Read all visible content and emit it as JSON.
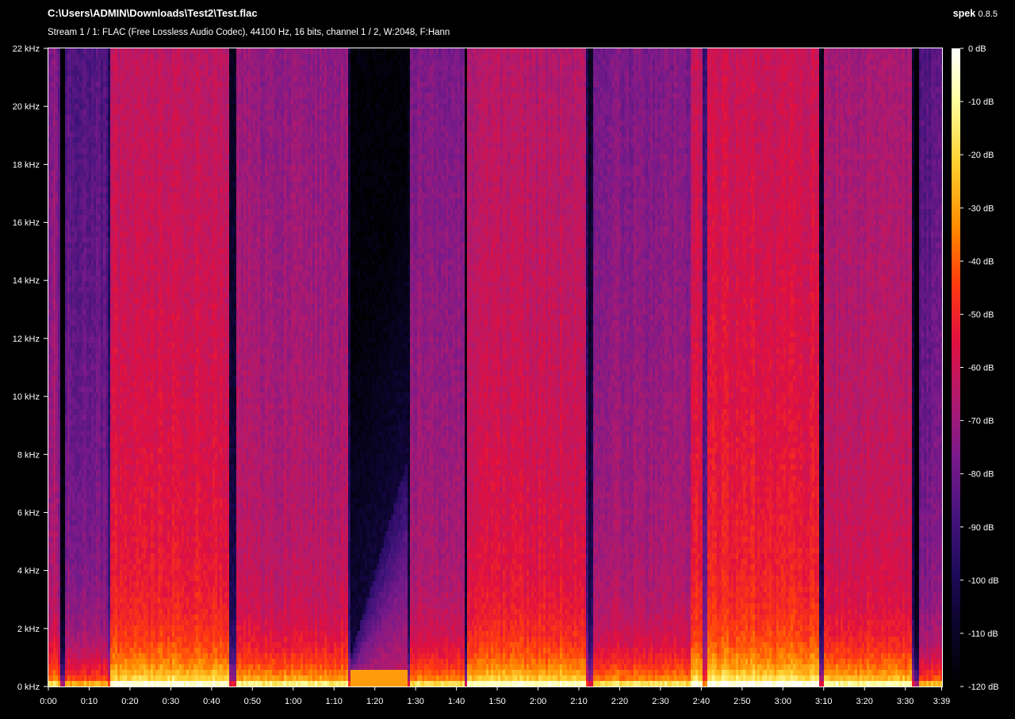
{
  "header": {
    "file_path": "C:\\Users\\ADMIN\\Downloads\\Test2\\Test.flac",
    "stream_info": "Stream 1 / 1: FLAC (Free Lossless Audio Codec), 44100 Hz, 16 bits, channel 1 / 2, W:2048, F:Hann",
    "app_name": "spek",
    "app_version": "0.8.5"
  },
  "colors": {
    "background": "#000000",
    "text": "#ffffff",
    "palette": [
      "#000000",
      "#0a0428",
      "#1e0a5a",
      "#46147d",
      "#7a1a8a",
      "#b01a6e",
      "#e01040",
      "#ff3a10",
      "#ff8a00",
      "#ffd030",
      "#ffffa0",
      "#ffffff"
    ]
  },
  "chart_data": {
    "type": "heatmap",
    "title": "",
    "xlabel": "",
    "ylabel": "",
    "x_ticks": [
      "0:00",
      "0:10",
      "0:20",
      "0:30",
      "0:40",
      "0:50",
      "1:00",
      "1:10",
      "1:20",
      "1:30",
      "1:40",
      "1:50",
      "2:00",
      "2:10",
      "2:20",
      "2:30",
      "2:40",
      "2:50",
      "3:00",
      "3:10",
      "3:20",
      "3:30",
      "3:39"
    ],
    "y_ticks": [
      "0 kHz",
      "2 kHz",
      "4 kHz",
      "6 kHz",
      "8 kHz",
      "10 kHz",
      "12 kHz",
      "14 kHz",
      "16 kHz",
      "18 kHz",
      "20 kHz",
      "22 kHz"
    ],
    "colorbar_ticks": [
      "0 dB",
      "-10 dB",
      "-20 dB",
      "-30 dB",
      "-40 dB",
      "-50 dB",
      "-60 dB",
      "-70 dB",
      "-80 dB",
      "-90 dB",
      "-100 dB",
      "-110 dB",
      "-120 dB"
    ],
    "xlim_seconds": [
      0,
      219
    ],
    "ylim_khz": [
      0,
      22
    ],
    "zlim_db": [
      -120,
      0
    ],
    "segments": [
      {
        "start": 0,
        "end": 2,
        "level": 0.45
      },
      {
        "start": 2,
        "end": 14.5,
        "level": 0.36
      },
      {
        "start": 14.5,
        "end": 44,
        "level": 0.55
      },
      {
        "start": 44,
        "end": 73.5,
        "level": 0.47
      },
      {
        "start": 73.5,
        "end": 88,
        "level": 0.22
      },
      {
        "start": 88,
        "end": 102,
        "level": 0.43
      },
      {
        "start": 102,
        "end": 118,
        "level": 0.53
      },
      {
        "start": 118,
        "end": 132,
        "level": 0.53
      },
      {
        "start": 132,
        "end": 157,
        "level": 0.44
      },
      {
        "start": 157,
        "end": 190,
        "level": 0.57
      },
      {
        "start": 190,
        "end": 212,
        "level": 0.5
      },
      {
        "start": 212,
        "end": 219,
        "level": 0.36
      }
    ],
    "dark_columns": [
      {
        "start": 2.5,
        "end": 4,
        "depth": 0.35
      },
      {
        "start": 14,
        "end": 15,
        "depth": 0.3
      },
      {
        "start": 44,
        "end": 45.5,
        "depth": 0.35
      },
      {
        "start": 73,
        "end": 74.5,
        "depth": 0.3
      },
      {
        "start": 87,
        "end": 88.5,
        "depth": 0.3
      },
      {
        "start": 101.5,
        "end": 102.5,
        "depth": 0.45
      },
      {
        "start": 131.5,
        "end": 133,
        "depth": 0.3
      },
      {
        "start": 160,
        "end": 161,
        "depth": 0.25
      },
      {
        "start": 188.5,
        "end": 189.5,
        "depth": 0.45
      },
      {
        "start": 211.5,
        "end": 213,
        "depth": 0.35
      }
    ]
  }
}
